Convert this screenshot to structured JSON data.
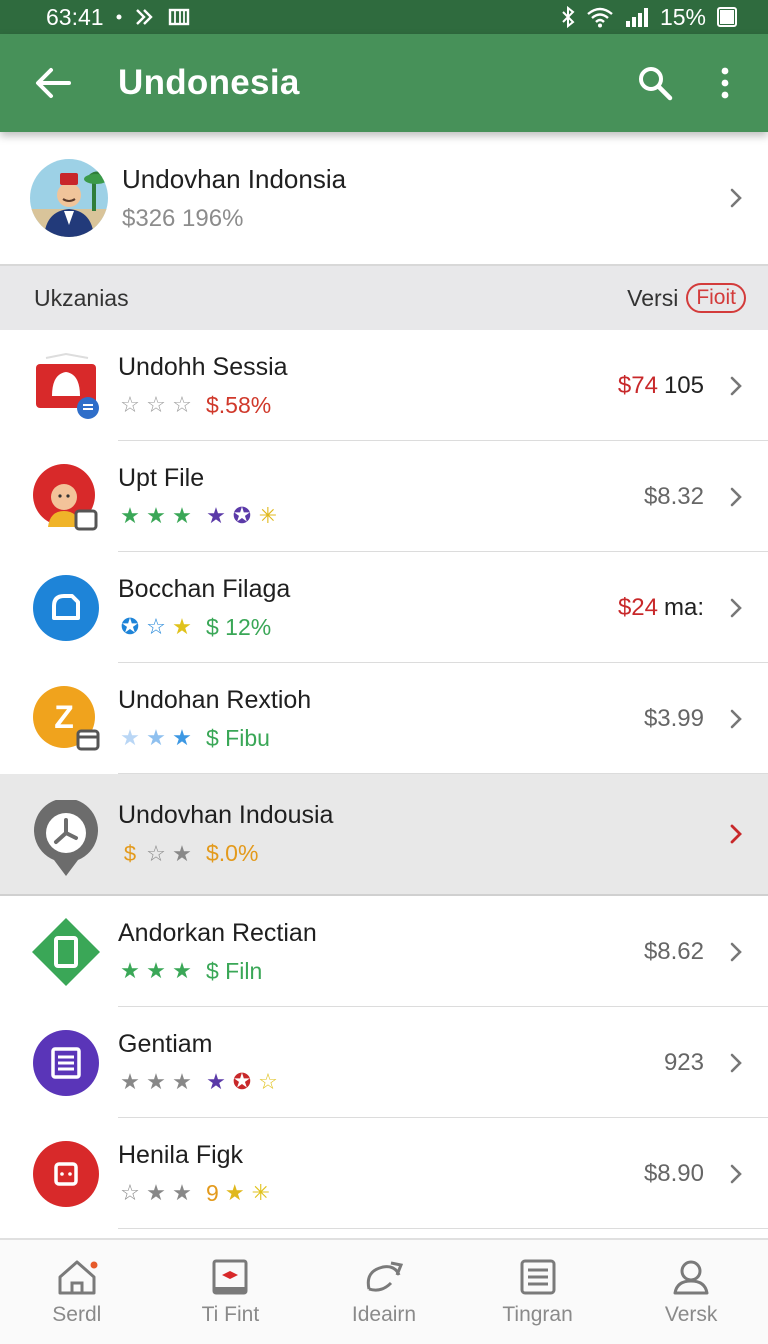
{
  "status_bar": {
    "time": "63:41",
    "battery": "15%"
  },
  "app_bar": {
    "title": "Undonesia"
  },
  "profile": {
    "name": "Undovhan Indonsia",
    "subtitle": "$326 196%"
  },
  "section": {
    "label": "Ukzanias",
    "right_label": "Versi",
    "badge": "Fioit"
  },
  "items": [
    {
      "name": "Undohh Sessia",
      "value": "$.58%",
      "value_color": "#d0392b",
      "price_red": "$74",
      "price_dark": "105",
      "price": "",
      "chevron_color": "#777777"
    },
    {
      "name": "Upt File",
      "value": "",
      "value_color": "#3aa757",
      "price_red": "",
      "price_dark": "",
      "price": "$8.32",
      "chevron_color": "#777777"
    },
    {
      "name": "Bocchan Filaga",
      "value": "$ 12%",
      "value_color": "#3aa757",
      "price_red": "$24",
      "price_dark": "ma:",
      "price": "",
      "chevron_color": "#777777"
    },
    {
      "name": "Undohan Rextioh",
      "value": "$ Fibu",
      "value_color": "#3aa757",
      "price_red": "",
      "price_dark": "",
      "price": "$3.99",
      "chevron_color": "#777777"
    },
    {
      "name": "Undovhan Indousia",
      "value": "$.0%",
      "value_color": "#e39a1c",
      "price_red": "",
      "price_dark": "",
      "price": "",
      "chevron_color": "#c8282a"
    },
    {
      "name": "Andorkan Rectian",
      "value": "$ Filn",
      "value_color": "#3aa757",
      "price_red": "",
      "price_dark": "",
      "price": "$8.62",
      "chevron_color": "#777777"
    },
    {
      "name": "Gentiam",
      "value": "",
      "value_color": "#3aa757",
      "price_red": "",
      "price_dark": "",
      "price": "923",
      "chevron_color": "#777777"
    },
    {
      "name": "Henila Figk",
      "value": "9",
      "value_color": "#e39a1c",
      "price_red": "",
      "price_dark": "",
      "price": "$8.90",
      "chevron_color": "#777777"
    }
  ],
  "bottom_nav": [
    {
      "label": "Serdl",
      "icon": "home-icon"
    },
    {
      "label": "Ti Fint",
      "icon": "tablet-icon"
    },
    {
      "label": "Ideairn",
      "icon": "refresh-icon"
    },
    {
      "label": "Tingran",
      "icon": "list-icon"
    },
    {
      "label": "Versk",
      "icon": "person-icon"
    }
  ],
  "colors": {
    "status_bar": "#2f6b3e",
    "app_bar": "#479159",
    "accent_red": "#c8282a",
    "star_green": "#3aa757",
    "star_purple": "#5b3aa8",
    "star_gold": "#e0b81c"
  }
}
